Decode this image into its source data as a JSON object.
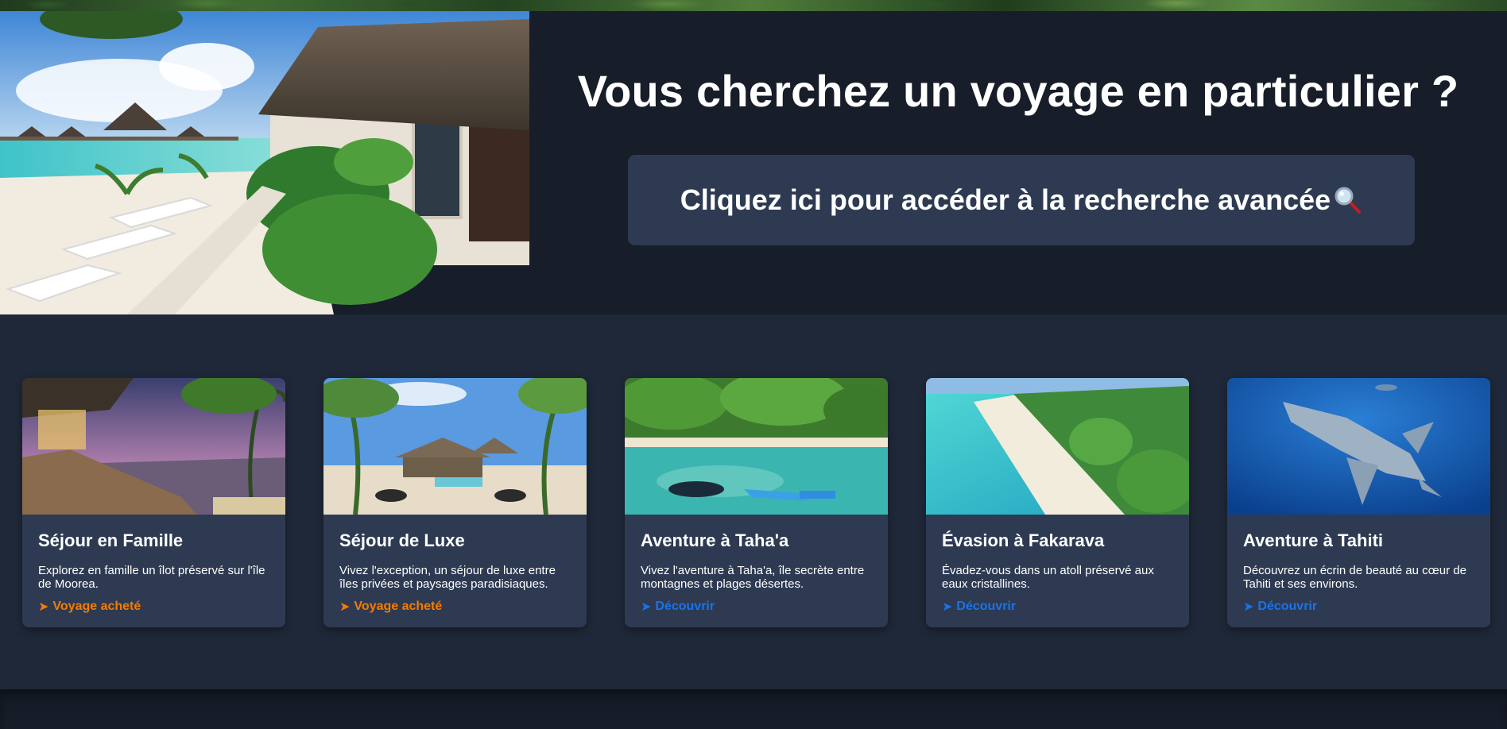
{
  "hero": {
    "title": "Vous cherchez un voyage en particulier ?",
    "search_button_label": "Cliquez ici pour accéder à la recherche avancée",
    "search_icon": "magnifying-glass-icon"
  },
  "cards": [
    {
      "title": "Séjour en Famille",
      "description": "Explorez en famille un îlot préservé sur l'île de Moorea.",
      "link_label": "Voyage acheté",
      "link_color": "#f57c00",
      "link_icon": "arrow-right-icon"
    },
    {
      "title": "Séjour de Luxe",
      "description": "Vivez l'exception, un séjour de luxe entre îles privées et paysages paradisiaques.",
      "link_label": "Voyage acheté",
      "link_color": "#f57c00",
      "link_icon": "arrow-right-icon"
    },
    {
      "title": "Aventure à Taha'a",
      "description": "Vivez l'aventure à Taha'a, île secrète entre montagnes et plages désertes.",
      "link_label": "Découvrir",
      "link_color": "#1a73e8",
      "link_icon": "arrow-right-icon"
    },
    {
      "title": "Évasion à Fakarava",
      "description": "Évadez-vous dans un atoll préservé aux eaux cristallines.",
      "link_label": "Découvrir",
      "link_color": "#1a73e8",
      "link_icon": "arrow-right-icon"
    },
    {
      "title": "Aventure à Tahiti",
      "description": "Découvrez un écrin de beauté au cœur de Tahiti et ses environs.",
      "link_label": "Découvrir",
      "link_color": "#1a73e8",
      "link_icon": "arrow-right-icon"
    }
  ],
  "colors": {
    "page_background": "#171d29",
    "section_background": "#1f2838",
    "card_background": "#2d3a52",
    "purchased_link": "#f57c00",
    "discover_link": "#1a73e8"
  }
}
